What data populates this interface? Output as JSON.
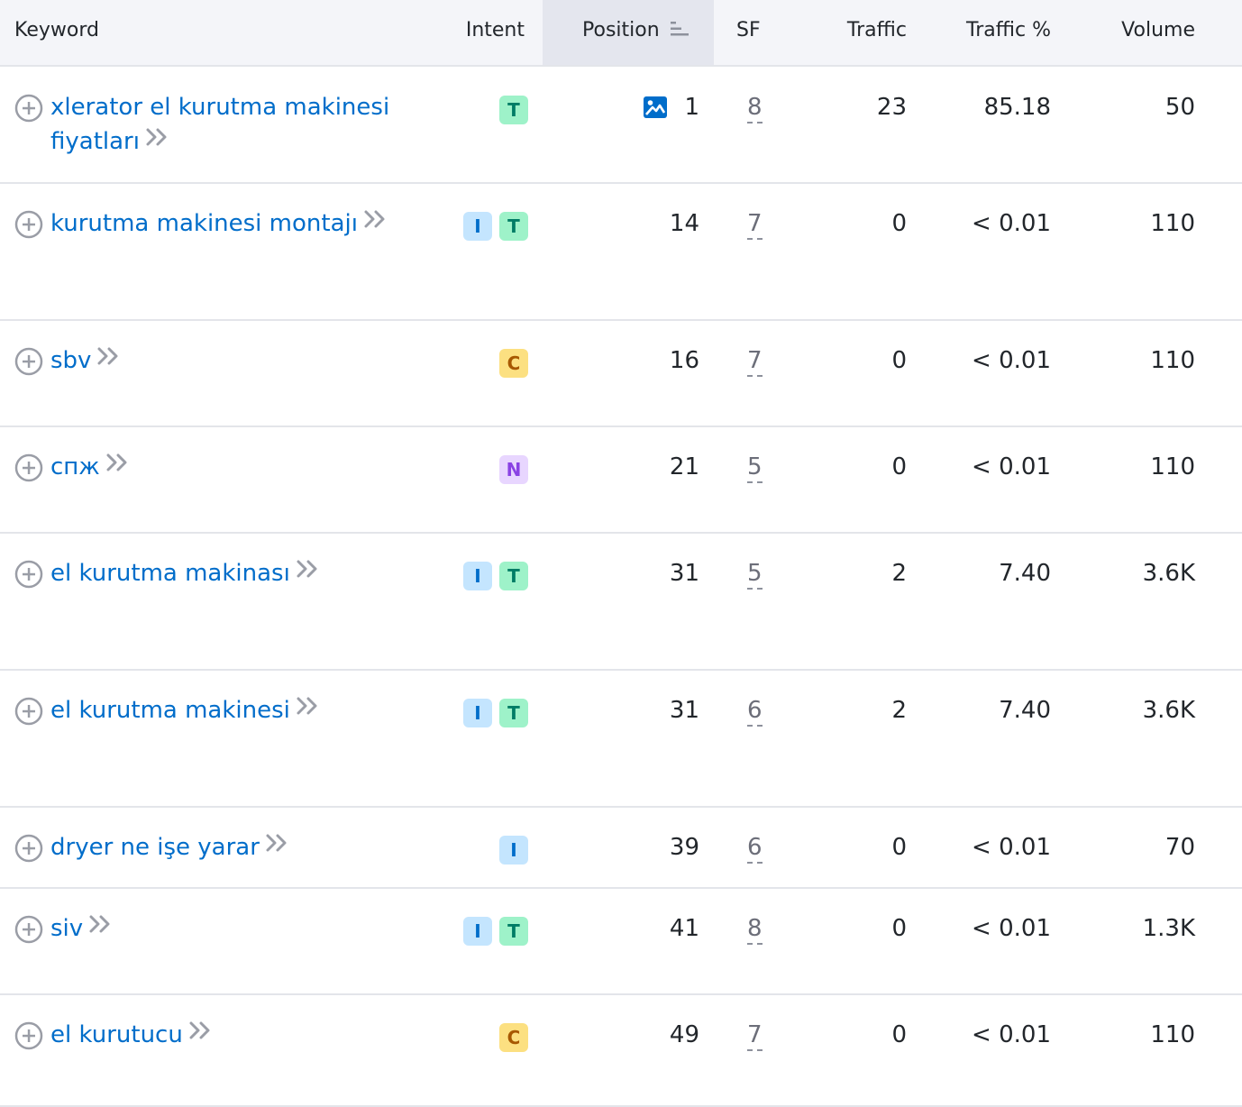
{
  "columns": {
    "keyword": "Keyword",
    "intent": "Intent",
    "position": "Position",
    "sf": "SF",
    "traffic": "Traffic",
    "traffic_pct": "Traffic %",
    "volume": "Volume"
  },
  "colors": {
    "link": "#006dca",
    "header_bg": "#f4f5f9",
    "sorted_header_bg": "#e4e6ee",
    "border": "#e3e5ea",
    "intent_I": "#c4e5fe",
    "intent_T": "#9ef2c9",
    "intent_C": "#fce081",
    "intent_N": "#e8d6ff"
  },
  "rows": [
    {
      "keyword": "xlerator el kurutma makinesi fiyatları",
      "intents": [
        "T"
      ],
      "position": "1",
      "position_feature_icon": "image-icon",
      "sf": "8",
      "traffic": "23",
      "traffic_pct": "85.18",
      "volume": "50"
    },
    {
      "keyword": "kurutma makinesi montajı",
      "intents": [
        "I",
        "T"
      ],
      "position": "14",
      "sf": "7",
      "traffic": "0",
      "traffic_pct": "< 0.01",
      "volume": "110"
    },
    {
      "keyword": "sbv",
      "intents": [
        "C"
      ],
      "position": "16",
      "sf": "7",
      "traffic": "0",
      "traffic_pct": "< 0.01",
      "volume": "110"
    },
    {
      "keyword": "спж",
      "intents": [
        "N"
      ],
      "position": "21",
      "sf": "5",
      "traffic": "0",
      "traffic_pct": "< 0.01",
      "volume": "110"
    },
    {
      "keyword": "el kurutma makinası",
      "intents": [
        "I",
        "T"
      ],
      "position": "31",
      "sf": "5",
      "traffic": "2",
      "traffic_pct": "7.40",
      "volume": "3.6K"
    },
    {
      "keyword": "el kurutma makinesi",
      "intents": [
        "I",
        "T"
      ],
      "position": "31",
      "sf": "6",
      "traffic": "2",
      "traffic_pct": "7.40",
      "volume": "3.6K"
    },
    {
      "keyword": "dryer ne işe yarar",
      "intents": [
        "I"
      ],
      "position": "39",
      "sf": "6",
      "traffic": "0",
      "traffic_pct": "< 0.01",
      "volume": "70"
    },
    {
      "keyword": "siv",
      "intents": [
        "I",
        "T"
      ],
      "position": "41",
      "sf": "8",
      "traffic": "0",
      "traffic_pct": "< 0.01",
      "volume": "1.3K"
    },
    {
      "keyword": "el kurutucu",
      "intents": [
        "C"
      ],
      "position": "49",
      "sf": "7",
      "traffic": "0",
      "traffic_pct": "< 0.01",
      "volume": "110"
    }
  ]
}
